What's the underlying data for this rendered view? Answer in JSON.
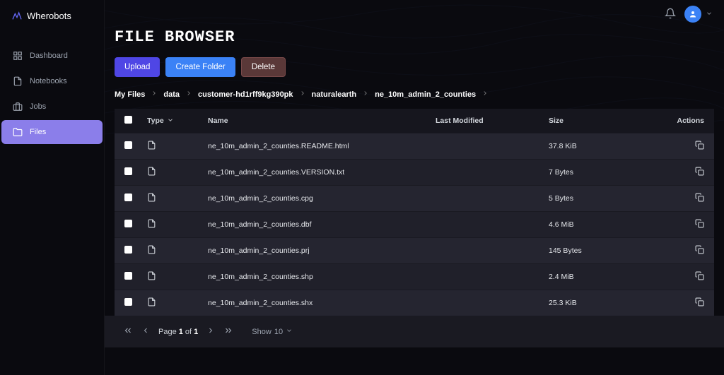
{
  "brand": "Wherobots",
  "sidebar": {
    "items": [
      {
        "label": "Dashboard",
        "icon": "dashboard"
      },
      {
        "label": "Notebooks",
        "icon": "notebook"
      },
      {
        "label": "Jobs",
        "icon": "jobs"
      },
      {
        "label": "Files",
        "icon": "files",
        "active": true
      }
    ]
  },
  "page": {
    "title": "FILE BROWSER"
  },
  "actions": {
    "upload": "Upload",
    "create_folder": "Create Folder",
    "delete": "Delete"
  },
  "breadcrumb": {
    "items": [
      "My Files",
      "data",
      "customer-hd1rff9kg390pk",
      "naturalearth",
      "ne_10m_admin_2_counties"
    ]
  },
  "table": {
    "columns": {
      "type": "Type",
      "name": "Name",
      "last_modified": "Last Modified",
      "size": "Size",
      "actions": "Actions"
    },
    "rows": [
      {
        "name": "ne_10m_admin_2_counties.README.html",
        "size": "37.8 KiB"
      },
      {
        "name": "ne_10m_admin_2_counties.VERSION.txt",
        "size": "7 Bytes"
      },
      {
        "name": "ne_10m_admin_2_counties.cpg",
        "size": "5 Bytes"
      },
      {
        "name": "ne_10m_admin_2_counties.dbf",
        "size": "4.6 MiB"
      },
      {
        "name": "ne_10m_admin_2_counties.prj",
        "size": "145 Bytes"
      },
      {
        "name": "ne_10m_admin_2_counties.shp",
        "size": "2.4 MiB"
      },
      {
        "name": "ne_10m_admin_2_counties.shx",
        "size": "25.3 KiB"
      }
    ]
  },
  "pagination": {
    "page_label_prefix": "Page ",
    "page_current": "1",
    "page_of": " of ",
    "page_total": "1",
    "show_label": "Show ",
    "show_count": "10"
  }
}
